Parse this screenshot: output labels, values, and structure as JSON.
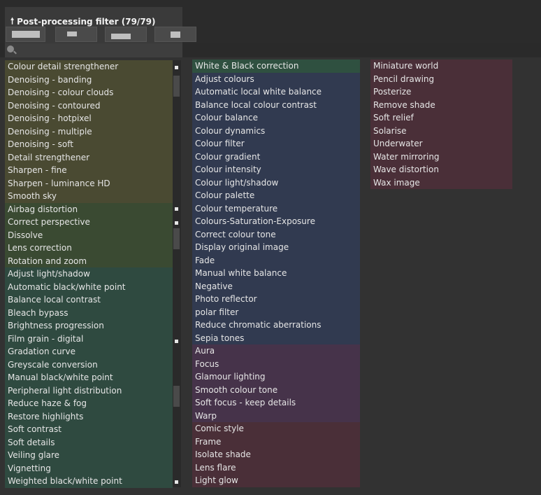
{
  "panel": {
    "title": "Post-processing filter (79/79)",
    "title_icon": "up-arrow-icon",
    "view_buttons": [
      "list-view-1",
      "list-view-2",
      "list-view-3",
      "list-view-4"
    ],
    "search": {
      "placeholder": "",
      "value": ""
    }
  },
  "colors": {
    "sharpness_group": "#4a4a32",
    "geometry_group": "#3a4a32",
    "exposure_group": "#2f4a40",
    "colour_group": "#313a50",
    "soft_group": "#46334a",
    "artistic_group": "#4a2f38",
    "wb_group": "#2f5040"
  },
  "column1": [
    {
      "label": "Colour detail strengthener",
      "group": "sharpness_group"
    },
    {
      "label": "Denoising - banding",
      "group": "sharpness_group"
    },
    {
      "label": "Denoising - colour clouds",
      "group": "sharpness_group"
    },
    {
      "label": "Denoising - contoured",
      "group": "sharpness_group"
    },
    {
      "label": "Denoising - hotpixel",
      "group": "sharpness_group"
    },
    {
      "label": "Denoising - multiple",
      "group": "sharpness_group"
    },
    {
      "label": "Denoising - soft",
      "group": "sharpness_group"
    },
    {
      "label": "Detail strengthener",
      "group": "sharpness_group"
    },
    {
      "label": "Sharpen - fine",
      "group": "sharpness_group"
    },
    {
      "label": "Sharpen - luminance HD",
      "group": "sharpness_group"
    },
    {
      "label": "Smooth sky",
      "group": "sharpness_group"
    },
    {
      "label": "Airbag distortion",
      "group": "geometry_group"
    },
    {
      "label": "Correct perspective",
      "group": "geometry_group"
    },
    {
      "label": "Dissolve",
      "group": "geometry_group"
    },
    {
      "label": "Lens correction",
      "group": "geometry_group"
    },
    {
      "label": "Rotation and zoom",
      "group": "geometry_group"
    },
    {
      "label": "Adjust light/shadow",
      "group": "exposure_group"
    },
    {
      "label": "Automatic black/white point",
      "group": "exposure_group"
    },
    {
      "label": "Balance local contrast",
      "group": "exposure_group"
    },
    {
      "label": "Bleach bypass",
      "group": "exposure_group"
    },
    {
      "label": "Brightness progression",
      "group": "exposure_group"
    },
    {
      "label": "Film grain - digital",
      "group": "exposure_group"
    },
    {
      "label": "Gradation curve",
      "group": "exposure_group"
    },
    {
      "label": "Greyscale conversion",
      "group": "exposure_group"
    },
    {
      "label": "Manual black/white point",
      "group": "exposure_group"
    },
    {
      "label": "Peripheral light distribution",
      "group": "exposure_group"
    },
    {
      "label": "Reduce haze & fog",
      "group": "exposure_group"
    },
    {
      "label": "Restore highlights",
      "group": "exposure_group"
    },
    {
      "label": "Soft contrast",
      "group": "exposure_group"
    },
    {
      "label": "Soft details",
      "group": "exposure_group"
    },
    {
      "label": "Veiling glare",
      "group": "exposure_group"
    },
    {
      "label": "Vignetting",
      "group": "exposure_group"
    },
    {
      "label": "Weighted black/white point",
      "group": "exposure_group"
    }
  ],
  "column2": [
    {
      "label": "White & Black correction",
      "group": "wb_group"
    },
    {
      "label": "Adjust colours",
      "group": "colour_group"
    },
    {
      "label": "Automatic local white balance",
      "group": "colour_group"
    },
    {
      "label": "Balance local colour contrast",
      "group": "colour_group"
    },
    {
      "label": "Colour balance",
      "group": "colour_group"
    },
    {
      "label": "Colour dynamics",
      "group": "colour_group"
    },
    {
      "label": "Colour filter",
      "group": "colour_group"
    },
    {
      "label": "Colour gradient",
      "group": "colour_group"
    },
    {
      "label": "Colour intensity",
      "group": "colour_group"
    },
    {
      "label": "Colour light/shadow",
      "group": "colour_group"
    },
    {
      "label": "Colour palette",
      "group": "colour_group"
    },
    {
      "label": "Colour temperature",
      "group": "colour_group"
    },
    {
      "label": "Colours-Saturation-Exposure",
      "group": "colour_group"
    },
    {
      "label": "Correct colour tone",
      "group": "colour_group"
    },
    {
      "label": "Display original image",
      "group": "colour_group"
    },
    {
      "label": "Fade",
      "group": "colour_group"
    },
    {
      "label": "Manual white balance",
      "group": "colour_group"
    },
    {
      "label": "Negative",
      "group": "colour_group"
    },
    {
      "label": "Photo reflector",
      "group": "colour_group"
    },
    {
      "label": "polar filter",
      "group": "colour_group"
    },
    {
      "label": "Reduce chromatic aberrations",
      "group": "colour_group"
    },
    {
      "label": "Sepia tones",
      "group": "colour_group"
    },
    {
      "label": "Aura",
      "group": "soft_group"
    },
    {
      "label": "Focus",
      "group": "soft_group"
    },
    {
      "label": "Glamour lighting",
      "group": "soft_group"
    },
    {
      "label": "Smooth colour tone",
      "group": "soft_group"
    },
    {
      "label": "Soft focus - keep details",
      "group": "soft_group"
    },
    {
      "label": "Warp",
      "group": "soft_group"
    },
    {
      "label": "Comic style",
      "group": "artistic_group"
    },
    {
      "label": "Frame",
      "group": "artistic_group"
    },
    {
      "label": "Isolate shade",
      "group": "artistic_group"
    },
    {
      "label": "Lens flare",
      "group": "artistic_group"
    },
    {
      "label": "Light glow",
      "group": "artistic_group"
    }
  ],
  "column3": [
    {
      "label": "Miniature world",
      "group": "artistic_group"
    },
    {
      "label": "Pencil drawing",
      "group": "artistic_group"
    },
    {
      "label": "Posterize",
      "group": "artistic_group"
    },
    {
      "label": "Remove shade",
      "group": "artistic_group"
    },
    {
      "label": "Soft relief",
      "group": "artistic_group"
    },
    {
      "label": "Solarise",
      "group": "artistic_group"
    },
    {
      "label": "Underwater",
      "group": "artistic_group"
    },
    {
      "label": "Water mirroring",
      "group": "artistic_group"
    },
    {
      "label": "Wave distortion",
      "group": "artistic_group"
    },
    {
      "label": "Wax image",
      "group": "artistic_group"
    }
  ]
}
